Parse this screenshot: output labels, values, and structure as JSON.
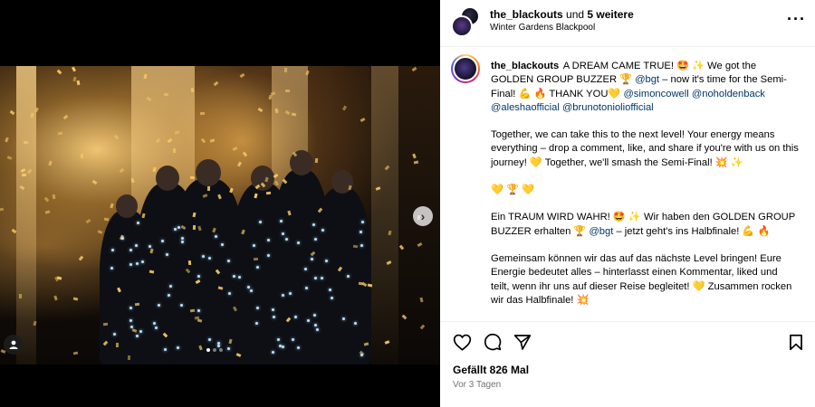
{
  "header": {
    "username": "the_blackouts",
    "and_text": " und ",
    "others": "5 weitere",
    "location": "Winter Gardens Blackpool"
  },
  "caption": {
    "username": "the_blackouts",
    "p1_a": " A DREAM CAME TRUE! 🤩 ✨ We got the GOLDEN GROUP BUZZER 🏆 ",
    "mention_bgt": "@bgt",
    "p1_b": " – now it's time for the Semi-Final! 💪 🔥 THANK YOU💛 ",
    "mention_simon": "@simoncowell",
    "mention_noholden": "@noholdenback",
    "mention_alesha": "@aleshaofficial",
    "mention_bruno": "@brunotonioliofficial",
    "p2": "Together, we can take this to the next level! Your energy means everything – drop a comment, like, and share if you're with us on this journey! 💛 Together, we'll smash the Semi-Final! 💥 ✨",
    "p3": "💛 🏆 💛",
    "p4_a": "Ein TRAUM WIRD WAHR! 🤩 ✨ Wir haben den GOLDEN GROUP BUZZER erhalten 🏆 ",
    "mention_bgt_2": "@bgt",
    "p4_b": " – jetzt geht's ins Halbfinale! 💪 🔥",
    "p5": "Gemeinsam können wir das auf das nächste Level bringen! Eure Energie bedeutet alles – hinterlasst einen Kommentar, liked und teilt, wenn ihr uns auf dieser Reise begleitet! 💛 Zusammen rocken wir das Halbfinale! 💥"
  },
  "actions": {
    "likes": "Gefällt 826 Mal",
    "timestamp": "Vor 3 Tagen"
  },
  "media": {
    "carousel_dots": 3,
    "active_dot": 0,
    "next_glyph": "›"
  },
  "colors": {
    "mention": "#00376b",
    "muted": "#737373",
    "confetti": "#f3c766"
  }
}
